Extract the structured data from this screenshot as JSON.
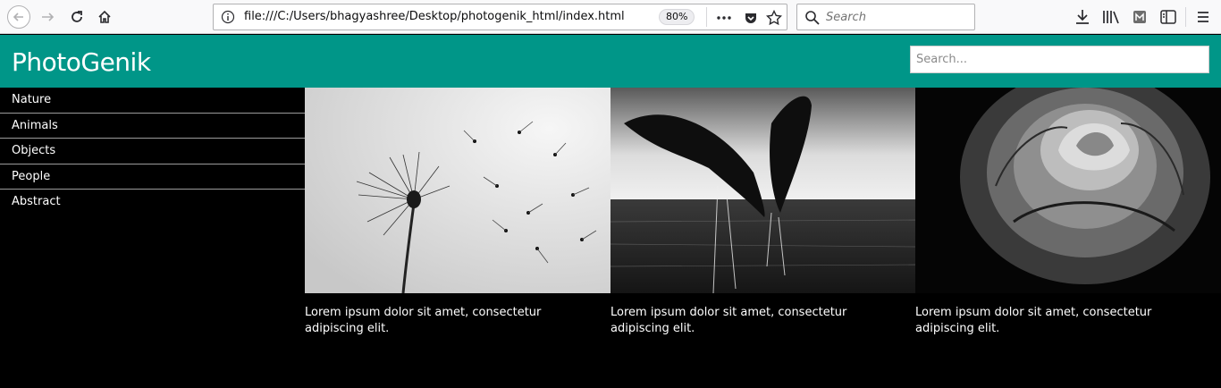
{
  "browser": {
    "url": "file:///C:/Users/bhagyashree/Desktop/photogenik_html/index.html",
    "zoom": "80%",
    "search_placeholder": "Search",
    "icons": [
      "back-icon",
      "forward-icon",
      "reload-icon",
      "home-icon",
      "info-icon",
      "more-icon",
      "pocket-icon",
      "star-icon",
      "search-icon",
      "download-icon",
      "library-icon",
      "extension-icon",
      "sidebar-icon",
      "menu-icon"
    ]
  },
  "site": {
    "title": "PhotoGenik",
    "search_placeholder": "Search...",
    "accent_color": "#009688"
  },
  "sidebar": {
    "items": [
      {
        "label": "Nature"
      },
      {
        "label": "Animals"
      },
      {
        "label": "Objects"
      },
      {
        "label": "People"
      },
      {
        "label": "Abstract"
      }
    ]
  },
  "gallery": {
    "cards": [
      {
        "subject": "dandelion",
        "caption": "Lorem ipsum dolor sit amet, consectetur adipiscing elit."
      },
      {
        "subject": "dolphins",
        "caption": "Lorem ipsum dolor sit amet, consectetur adipiscing elit."
      },
      {
        "subject": "rose",
        "caption": "Lorem ipsum dolor sit amet, consectetur adipiscing elit."
      }
    ]
  }
}
